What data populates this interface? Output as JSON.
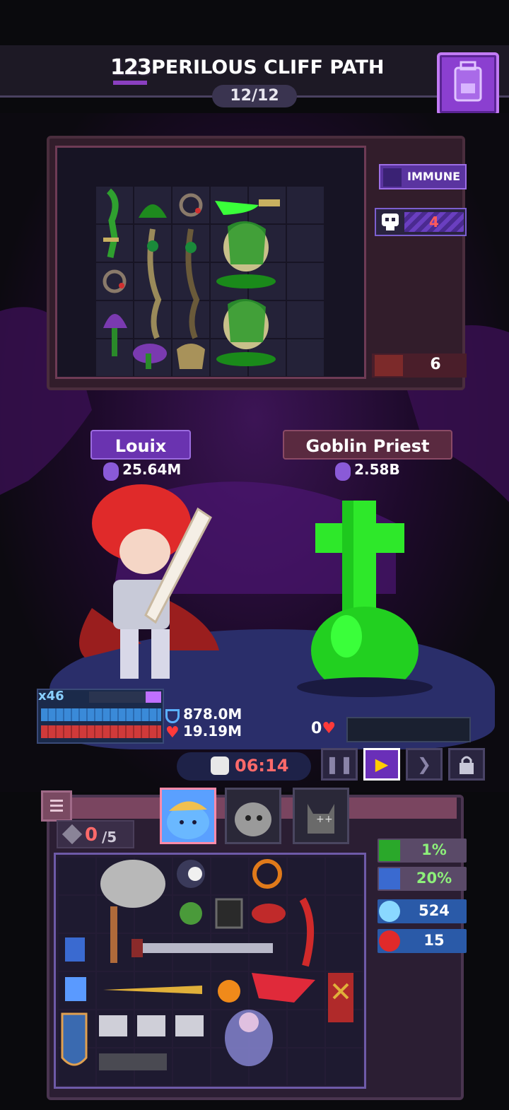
{
  "header": {
    "stage_number": "123",
    "title": "PERILOUS CLIFF PATH",
    "progress": "12/12"
  },
  "enemy_status": {
    "immune_label": "IMMUNE",
    "skull_count": "4",
    "rage_count": "6"
  },
  "hero": {
    "name": "Louix",
    "power": "25.64M",
    "multiplier": "x46",
    "shield": "878.0M",
    "hp": "19.19M"
  },
  "enemy": {
    "name": "Goblin Priest",
    "power": "2.58B",
    "hp": "0"
  },
  "battle": {
    "timer": "06:14"
  },
  "inventory": {
    "slots_used": "0",
    "slots_max": "/5",
    "stats": [
      {
        "icon": "heal-plus-icon",
        "value": "1%",
        "color": "#5a4a68",
        "text_color": "#8df07a"
      },
      {
        "icon": "speed-icon",
        "value": "20%",
        "color": "#5a4a68",
        "text_color": "#8df07a"
      },
      {
        "icon": "gem-icon",
        "value": "524",
        "color": "#2a5aa8",
        "text_color": "#ffffff"
      },
      {
        "icon": "demon-icon",
        "value": "15",
        "color": "#2a5aa8",
        "text_color": "#ffffff"
      }
    ]
  },
  "colors": {
    "accent_purple": "#8b3fd0",
    "hp_red": "#d03a3a",
    "shield_blue": "#3a8ad8",
    "timer_red": "#ff6a6a",
    "toxic_green": "#2ee82a"
  }
}
